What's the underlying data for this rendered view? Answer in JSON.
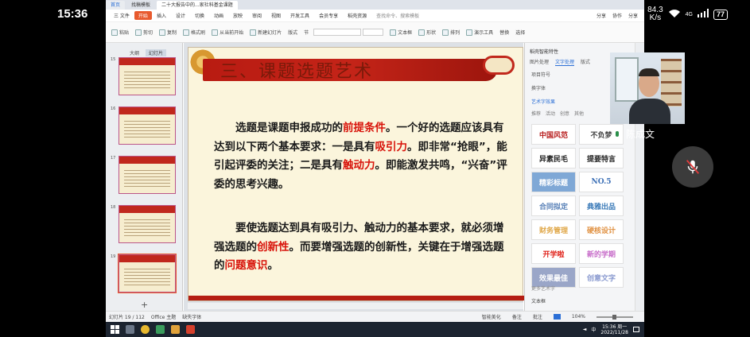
{
  "phone_status": {
    "time": "15:36",
    "net_speed_value": "84.3",
    "net_speed_unit": "K/s",
    "network": "4G",
    "battery": "77"
  },
  "browser_tabs": [
    {
      "label": "首页"
    },
    {
      "label": "找稿模板"
    },
    {
      "label": "二十大报告中的...家社科基金课题"
    }
  ],
  "menu": {
    "file": "三 文件",
    "items": [
      "开始",
      "插入",
      "设计",
      "切换",
      "动画",
      "放映",
      "审阅",
      "视图",
      "开发工具",
      "会员专享",
      "稻壳资源"
    ],
    "search": "查找命令、搜索模板",
    "right": [
      "分享",
      "协作",
      "分享"
    ]
  },
  "ribbon": {
    "items": [
      "粘贴",
      "剪切",
      "复制",
      "格式刷",
      "从当前开始",
      "新建幻灯片",
      "版式",
      "节",
      "重置",
      "文本框",
      "形状",
      "排列",
      "演示工具",
      "替换",
      "选择"
    ]
  },
  "thumb_pane": {
    "tabs": [
      "大纲",
      "幻灯片"
    ],
    "numbers": [
      "15",
      "16",
      "17",
      "18",
      "19"
    ]
  },
  "slide": {
    "title": "三、课题选题艺术",
    "p1": {
      "a": "选题是课题申报成功的",
      "b": "前提条件",
      "c": "。一个好的选题应该具有达到以下两个基本要求：一是具有",
      "d": "吸引力",
      "e": "。即非常“抢眼”，能引起评委的关注；二是具有",
      "f": "触动力",
      "g": "。即能激发共鸣，“兴奋”评委的思考兴趣。"
    },
    "p2": {
      "a": "要使选题达到具有吸引力、触动力的基本要求，就必须增强选题的",
      "b": "创新性",
      "c": "。而要增强选题的创新性，关键在于增强选题的",
      "d": "问题意识",
      "e": "。"
    }
  },
  "right_pane": {
    "header": "稻壳智能特性",
    "tabs": [
      "图片处理",
      "文字处理",
      "版式"
    ],
    "items": [
      "项目符号",
      "换字体",
      "艺术字效果"
    ],
    "sub_tabs": [
      "推荐",
      "活动",
      "创意",
      "其他"
    ],
    "styles": [
      "中国风范",
      "不负梦",
      "异素民毛",
      "提要特言",
      "精彩标题",
      "NO.5",
      "合同拟定",
      "典雅出品",
      "财务管理",
      "硬核设计",
      "开学啦",
      "新的学期",
      "效果最佳",
      "创意文字"
    ],
    "foot1": "更多艺术字",
    "foot2": "文本框"
  },
  "status_bar": {
    "slide": "幻灯片 19 / 112",
    "theme": "Office 主题",
    "font": "缺失字体",
    "smart": "智能美化",
    "notes": "备注",
    "comments": "批注",
    "zoom": "104%"
  },
  "taskbar": {
    "time": "15:36 周一",
    "date": "2022/11/28",
    "lang": "中"
  },
  "video": {
    "name": "陈成文"
  }
}
